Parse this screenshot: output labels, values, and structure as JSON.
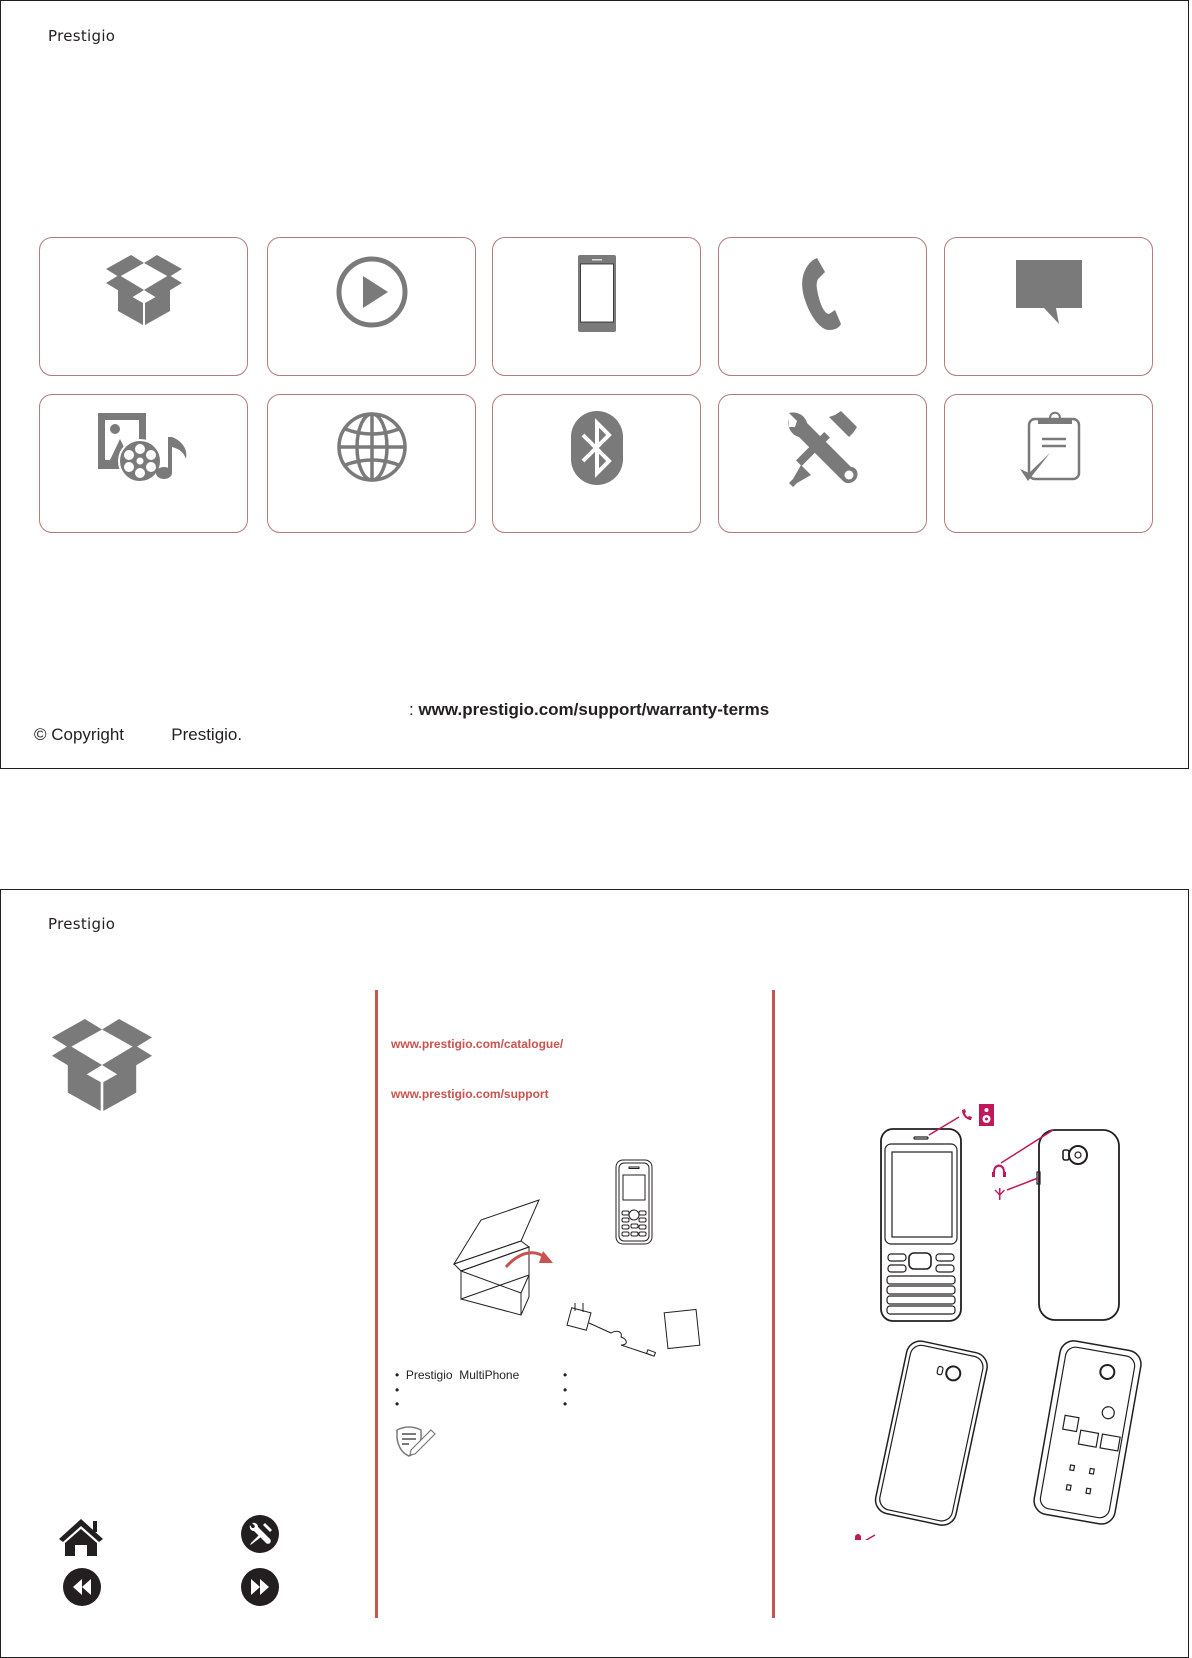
{
  "page1": {
    "logo": "Prestigio",
    "tiles": [
      {
        "icon": "open-box-icon"
      },
      {
        "icon": "play-circle-icon"
      },
      {
        "icon": "smartphone-icon"
      },
      {
        "icon": "phone-handset-icon"
      },
      {
        "icon": "speech-bubble-icon"
      },
      {
        "icon": "multimedia-icon"
      },
      {
        "icon": "globe-icon"
      },
      {
        "icon": "bluetooth-icon"
      },
      {
        "icon": "tools-icon"
      },
      {
        "icon": "clipboard-check-icon"
      }
    ],
    "warranty_prefix": ": ",
    "warranty_link": "www.prestigio.com/support/warranty-terms",
    "copyright": "© Copyright          Prestigio."
  },
  "page2": {
    "logo": "Prestigio",
    "links": {
      "catalogue": "www.prestigio.com/catalogue/",
      "support": "www.prestigio.com/support"
    },
    "box_contents_left": [
      "Prestigio  MultiPhone",
      "",
      ""
    ],
    "box_contents_right": [
      "",
      "",
      ""
    ],
    "bullet": "•",
    "colors": {
      "accent": "#c9534f",
      "callout": "#c2185b",
      "icon_gray": "#7a7a7a"
    },
    "nav": [
      "home-icon",
      "tools-circle-icon",
      "rewind-icon",
      "fast-forward-icon"
    ]
  }
}
